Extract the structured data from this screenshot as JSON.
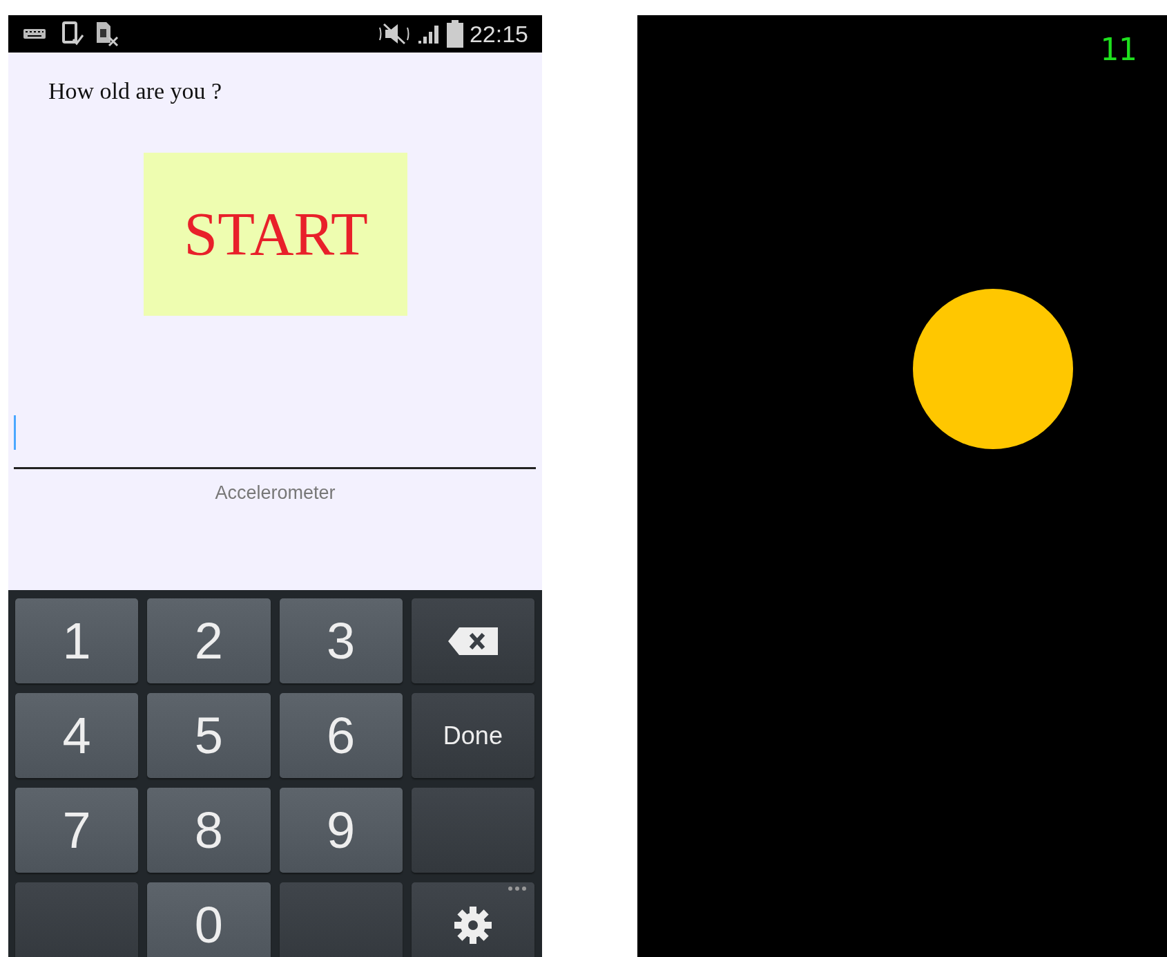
{
  "status_bar": {
    "time": "22:15"
  },
  "question": "How old are you ?",
  "start_button": "START",
  "answer_field": {
    "focused": true
  },
  "caption": "Accelerometer",
  "keypad": [
    {
      "kind": "digit",
      "label": "1"
    },
    {
      "kind": "digit",
      "label": "2"
    },
    {
      "kind": "digit",
      "label": "3"
    },
    {
      "kind": "backspace"
    },
    {
      "kind": "digit",
      "label": "4"
    },
    {
      "kind": "digit",
      "label": "5"
    },
    {
      "kind": "digit",
      "label": "6"
    },
    {
      "kind": "done",
      "label": "Done"
    },
    {
      "kind": "digit",
      "label": "7"
    },
    {
      "kind": "digit",
      "label": "8"
    },
    {
      "kind": "digit",
      "label": "9"
    },
    {
      "kind": "blank"
    },
    {
      "kind": "blank"
    },
    {
      "kind": "digit",
      "label": "0"
    },
    {
      "kind": "blank"
    },
    {
      "kind": "settings"
    }
  ],
  "game": {
    "score": "11"
  }
}
